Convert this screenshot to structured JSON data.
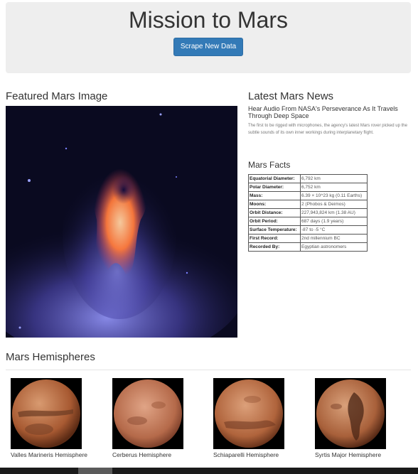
{
  "header": {
    "title": "Mission to Mars",
    "scrape_button": "Scrape New Data"
  },
  "featured": {
    "heading": "Featured Mars Image"
  },
  "news": {
    "heading": "Latest Mars News",
    "headline": "Hear Audio From NASA's Perseverance As It Travels Through Deep Space",
    "paragraph": "The first to be rigged with microphones, the agency's latest Mars rover picked up the subtle sounds of its own inner workings during interplanetary flight."
  },
  "facts": {
    "heading": "Mars Facts",
    "rows": [
      {
        "label": "Equatorial Diameter:",
        "value": "6,792 km"
      },
      {
        "label": "Polar Diameter:",
        "value": "6,752 km"
      },
      {
        "label": "Mass:",
        "value": "6.39 × 10^23 kg (0.11 Earths)"
      },
      {
        "label": "Moons:",
        "value": "2 (Phobos & Deimos)"
      },
      {
        "label": "Orbit Distance:",
        "value": "227,943,824 km (1.38 AU)"
      },
      {
        "label": "Orbit Period:",
        "value": "687 days (1.9 years)"
      },
      {
        "label": "Surface Temperature:",
        "value": "-87 to -5 °C"
      },
      {
        "label": "First Record:",
        "value": "2nd millennium BC"
      },
      {
        "label": "Recorded By:",
        "value": "Egyptian astronomers"
      }
    ]
  },
  "hemispheres": {
    "heading": "Mars Hemispheres",
    "items": [
      {
        "title": "Valles Marineris Hemisphere"
      },
      {
        "title": "Cerberus Hemisphere"
      },
      {
        "title": "Schiaparelli Hemisphere"
      },
      {
        "title": "Syrtis Major Hemisphere"
      }
    ]
  }
}
